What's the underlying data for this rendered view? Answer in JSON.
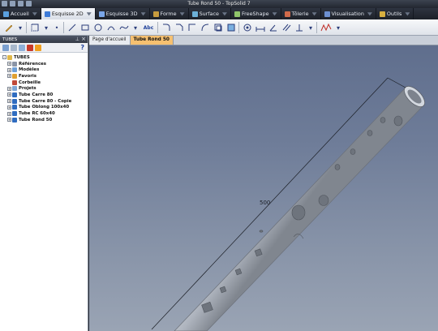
{
  "window": {
    "title": "Tube Rond 50 - TopSolid 7"
  },
  "ribbon": {
    "tabs": [
      {
        "label": "Accueil",
        "icon": "home-icon",
        "color": "#5aa0e0"
      },
      {
        "label": "Esquisse 2D",
        "icon": "sketch-2d-icon",
        "color": "#3d7bd8"
      },
      {
        "label": "Esquisse 3D",
        "icon": "sketch-3d-icon",
        "color": "#7aa6e8"
      },
      {
        "label": "Forme",
        "icon": "shape-icon",
        "color": "#c79b3e"
      },
      {
        "label": "Surface",
        "icon": "surface-icon",
        "color": "#6cb0d8"
      },
      {
        "label": "FreeShape",
        "icon": "freeshape-icon",
        "color": "#8fc46a"
      },
      {
        "label": "Tôlerie",
        "icon": "sheet-metal-icon",
        "color": "#d06a4a"
      },
      {
        "label": "Visualisation",
        "icon": "eye-icon",
        "color": "#6c8fd0"
      },
      {
        "label": "Outils",
        "icon": "tools-icon",
        "color": "#d8b040"
      }
    ],
    "active_tab": "Esquisse 2D",
    "toolbar_text_label": "Abc"
  },
  "panel": {
    "title": "TUBES",
    "help_symbol": "?",
    "tree": [
      {
        "label": "TUBES",
        "level": 0,
        "icon": "folder-icon",
        "expander": "-"
      },
      {
        "label": "Références",
        "level": 1,
        "icon": "references-icon",
        "expander": "+"
      },
      {
        "label": "Modèles",
        "level": 1,
        "icon": "models-icon",
        "expander": "+"
      },
      {
        "label": "Favoris",
        "level": 1,
        "icon": "favorites-icon",
        "expander": "+"
      },
      {
        "label": "Corbeille",
        "level": 1,
        "icon": "trash-icon",
        "expander": ""
      },
      {
        "label": "Projets",
        "level": 1,
        "icon": "projects-icon",
        "expander": "+"
      },
      {
        "label": "Tube Carre 80",
        "level": 1,
        "icon": "part-icon",
        "expander": "+"
      },
      {
        "label": "Tube Carre 80 - Copie",
        "level": 1,
        "icon": "part-icon",
        "expander": "+"
      },
      {
        "label": "Tube Oblong 100x40",
        "level": 1,
        "icon": "part-icon",
        "expander": "+"
      },
      {
        "label": "Tube RC 60x40",
        "level": 1,
        "icon": "part-icon",
        "expander": "+"
      },
      {
        "label": "Tube Rond 50",
        "level": 1,
        "icon": "part-icon",
        "expander": "+"
      }
    ]
  },
  "document_tabs": [
    {
      "label": "Page d'accueil",
      "active": false
    },
    {
      "label": "Tube Rond 50",
      "active": true
    }
  ],
  "viewport": {
    "dimension_label": "500",
    "colors": {
      "tube": "#a9afb8",
      "background": "#6f7d99"
    }
  }
}
